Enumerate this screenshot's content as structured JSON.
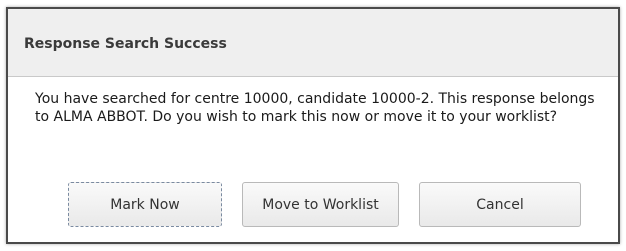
{
  "dialog": {
    "title": "Response Search Success",
    "message": "You have searched for centre 10000, candidate 10000-2. This response belongs to ALMA ABBOT. Do you wish to mark this now or move it to your worklist?",
    "buttons": {
      "mark_now": "Mark Now",
      "move_to_worklist": "Move to Worklist",
      "cancel": "Cancel"
    }
  },
  "colors": {
    "header_background": "#efefef",
    "border": "#4a4a4a",
    "title_text": "#3a3a3a"
  }
}
